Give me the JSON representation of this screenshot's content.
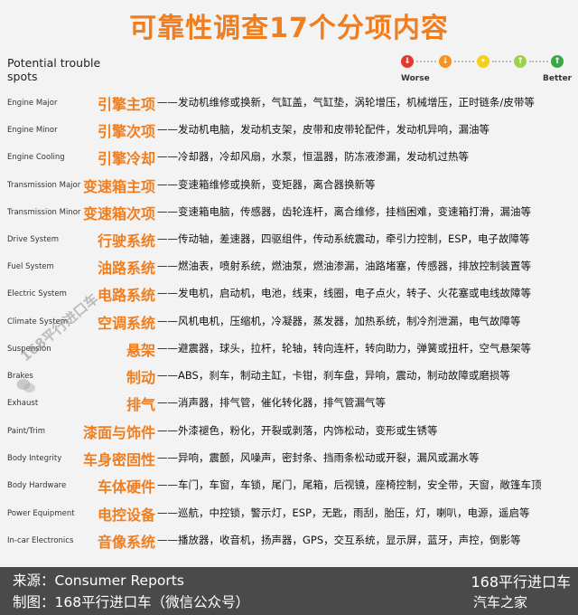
{
  "title": "可靠性调查17个分项内容",
  "header_label_line1": "Potential trouble",
  "header_label_line2": "spots",
  "legend": {
    "worse": "Worse",
    "better": "Better",
    "colors": [
      "#e23a2c",
      "#f5931e",
      "#f6cf1c",
      "#9fd24a",
      "#3aa845"
    ]
  },
  "rows": [
    {
      "en": "Engine Major",
      "zh": "引擎主项",
      "desc": "——发动机维修或换新，气缸盖，气缸垫，涡轮增压，机械增压，正时链条/皮带等"
    },
    {
      "en": "Engine Minor",
      "zh": "引擎次项",
      "desc": "——发动机电脑，发动机支架，皮带和皮带轮配件，发动机异响，漏油等"
    },
    {
      "en": "Engine Cooling",
      "zh": "引擎冷却",
      "desc": "——冷却器，冷却风扇，水泵，恒温器，防冻液渗漏，发动机过热等"
    },
    {
      "en": "Transmission Major",
      "zh": "变速箱主项",
      "desc": "——变速箱维修或换新，变矩器，离合器换新等"
    },
    {
      "en": "Transmission Minor",
      "zh": "变速箱次项",
      "desc": "——变速箱电脑，传感器，齿轮连杆，离合维修，挂档困难，变速箱打滑，漏油等"
    },
    {
      "en": "Drive System",
      "zh": "行驶系统",
      "desc": "——传动轴，差速器，四驱组件，传动系统震动，牵引力控制，ESP，电子故障等"
    },
    {
      "en": "Fuel System",
      "zh": "油路系统",
      "desc": "——燃油表，喷射系统，燃油泵，燃油渗漏，油路堵塞，传感器，排放控制装置等"
    },
    {
      "en": "Electric System",
      "zh": "电路系统",
      "desc": "——发电机，启动机，电池，线束，线圈，电子点火，转子、火花塞或电线故障等"
    },
    {
      "en": "Climate System",
      "zh": "空调系统",
      "desc": "——风机电机，压缩机，冷凝器，蒸发器，加热系统，制冷剂泄漏，电气故障等"
    },
    {
      "en": "Suspension",
      "zh": "悬架",
      "desc": "——避震器，球头，拉杆，轮轴，转向连杆，转向助力，弹簧或扭杆，空气悬架等"
    },
    {
      "en": "Brakes",
      "zh": "制动",
      "desc": "——ABS，刹车，制动主缸，卡钳，刹车盘，异响，震动，制动故障或磨损等"
    },
    {
      "en": "Exhaust",
      "zh": "排气",
      "desc": "——消声器，排气管，催化转化器，排气管漏气等"
    },
    {
      "en": "Paint/Trim",
      "zh": "漆面与饰件",
      "desc": "——外漆褪色，粉化，开裂或剥落，内饰松动，变形或生锈等"
    },
    {
      "en": "Body Integrity",
      "zh": "车身密固性",
      "desc": "——异响，震颤，风噪声，密封条、挡雨条松动或开裂，漏风或漏水等"
    },
    {
      "en": "Body Hardware",
      "zh": "车体硬件",
      "desc": "——车门，车窗，车锁，尾门，尾箱，后视镜，座椅控制，安全带，天窗，敞篷车顶"
    },
    {
      "en": "Power Equipment",
      "zh": "电控设备",
      "desc": "——巡航，中控锁，警示灯，ESP，无匙，雨刮，胎压，灯，喇叭，电源，遥启等"
    },
    {
      "en": "In-car Electronics",
      "zh": "音像系统",
      "desc": "——播放器，收音机，扬声器，GPS，交互系统，显示屏，蓝牙，声控，倒影等"
    }
  ],
  "watermark": "168平行进口车",
  "footer": {
    "source": "来源：Consumer Reports",
    "credit": "制图：168平行进口车（微信公众号）",
    "brand": "168平行进口车",
    "site": "汽车之家"
  }
}
